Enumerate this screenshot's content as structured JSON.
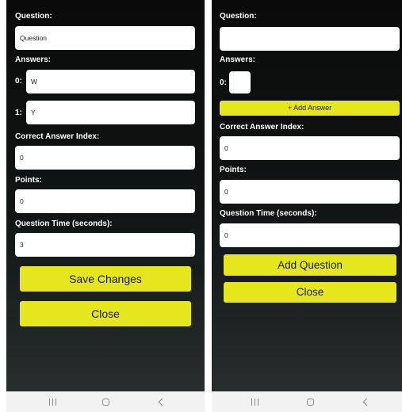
{
  "left": {
    "question_label": "Question:",
    "question_value": "Question",
    "answers_label": "Answers:",
    "answers": [
      {
        "index": "0:",
        "value": "W"
      },
      {
        "index": "1:",
        "value": "Y"
      }
    ],
    "correct_index_label": "Correct Answer Index:",
    "correct_index_value": "0",
    "points_label": "Points:",
    "points_value": "0",
    "time_label": "Question Time (seconds):",
    "time_value": "3",
    "save_button": "Save Changes",
    "close_button": "Close"
  },
  "right": {
    "question_label": "Question:",
    "question_value": "",
    "answers_label": "Answers:",
    "answers": [
      {
        "index": "0:",
        "value": ""
      }
    ],
    "add_answer_button": "+ Add Answer",
    "correct_index_label": "Correct Answer Index:",
    "correct_index_value": "0",
    "points_label": "Points:",
    "points_value": "0",
    "time_label": "Question Time (seconds):",
    "time_value": "0",
    "add_question_button": "Add Question",
    "close_button": "Close"
  },
  "colors": {
    "accent": "#e6e61e",
    "background": "#0a0a0a",
    "navbar": "#f2f2f2"
  },
  "navbar_icons": [
    "recent-apps-icon",
    "home-icon",
    "back-icon"
  ]
}
